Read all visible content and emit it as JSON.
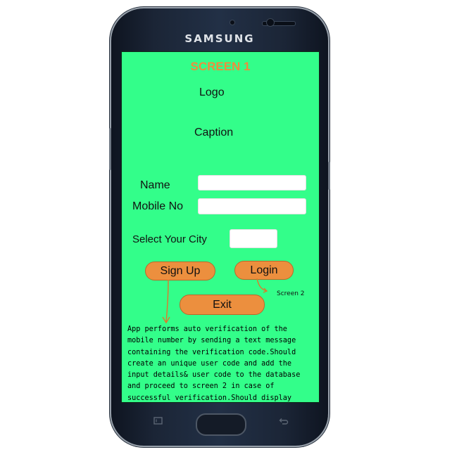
{
  "device": {
    "brand": "SAMSUNG"
  },
  "screen": {
    "title": "SCREEN 1",
    "logo": "Logo",
    "caption": "Caption",
    "name_label": "Name",
    "mobile_label": "Mobile No",
    "name_value": "",
    "mobile_value": "",
    "city_label": "Select Your City",
    "city_value": "",
    "signup_label": "Sign Up",
    "login_label": "Login",
    "login_target": "Screen 2",
    "exit_label": "Exit",
    "note": "App performs auto verification of the mobile number by sending a text message containing the verification code.Should create an unique user code and add the input details& user code to the database and proceed to screen 2 in case of successful verification.Should display error info otherwise."
  },
  "colors": {
    "screen_bg": "#33fe8a",
    "accent": "#ec8f3e",
    "title": "#f08c3c"
  },
  "icons": [
    "recent-apps-icon",
    "back-icon",
    "front-camera-icon",
    "home-button"
  ]
}
